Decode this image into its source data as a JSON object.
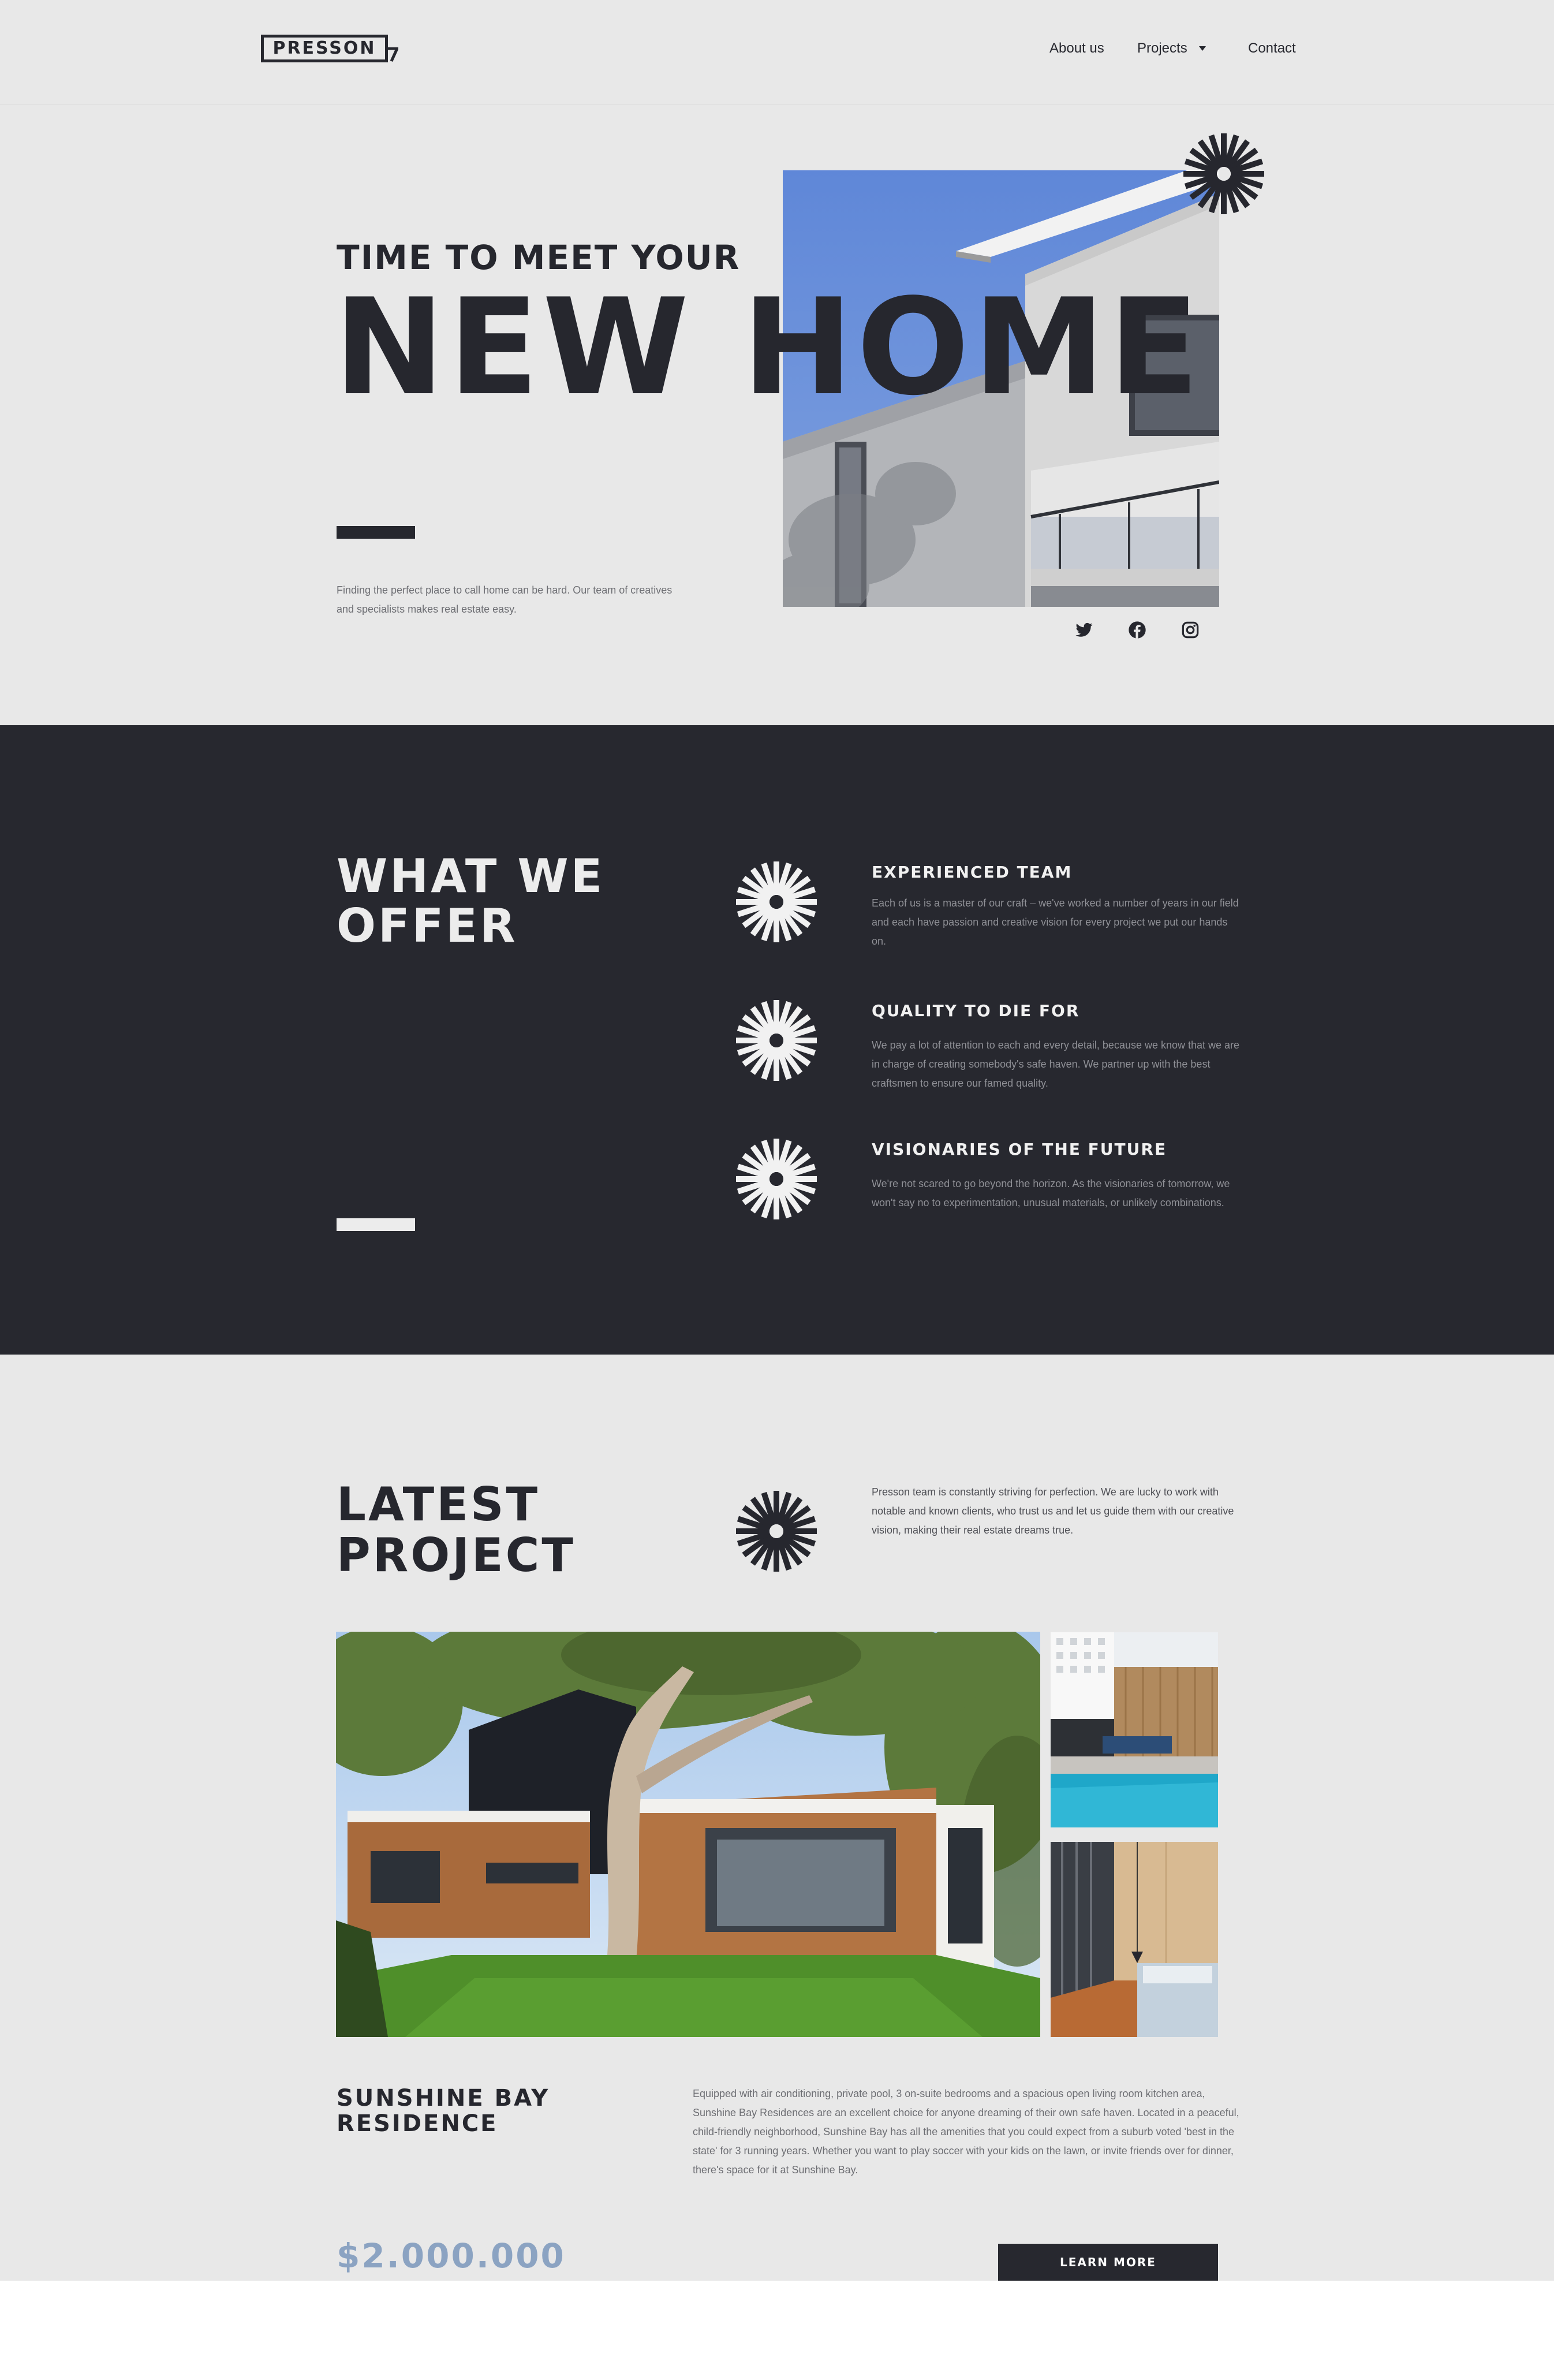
{
  "header": {
    "logo": "PRESSON",
    "nav": [
      {
        "label": "About us"
      },
      {
        "label": "Projects"
      },
      {
        "label": "Contact"
      }
    ]
  },
  "hero": {
    "kicker": "TIME TO MEET YOUR",
    "title": "NEW HOME",
    "description": "Finding the perfect place to call home can be hard. Our team of creatives and specialists makes real estate easy.",
    "social": [
      "twitter-icon",
      "facebook-icon",
      "instagram-icon"
    ]
  },
  "offer": {
    "title_line1": "WHAT WE",
    "title_line2": "OFFER",
    "features": [
      {
        "title": "EXPERIENCED TEAM",
        "text": "Each of us is a master of our craft – we've worked a number of years in our field and each have passion and creative vision for every project we put our hands on."
      },
      {
        "title": "QUALITY TO DIE FOR",
        "text": "We pay a lot of attention to each and every detail, because we know that we are in charge of creating somebody's safe haven. We partner up with the best craftsmen to ensure our famed quality."
      },
      {
        "title": "VISIONARIES OF THE FUTURE",
        "text": "We're not scared to go beyond the horizon. As the visionaries of tomorrow, we won't say no to experimentation, unusual materials, or unlikely combinations."
      }
    ]
  },
  "latest": {
    "title_line1": "LATEST",
    "title_line2": "PROJECT",
    "description": "Presson team is constantly striving for perfection. We are lucky to work with notable and known clients, who trust us and let us guide them with our creative vision, making their real estate dreams true.",
    "project_name": "SUNSHINE BAY RESIDENCE",
    "project_description": "Equipped with air conditioning, private pool, 3 on-suite bedrooms and a spacious open living room kitchen area, Sunshine Bay Residences are an excellent choice for anyone dreaming of their own safe haven. Located in a peaceful, child-friendly neighborhood, Sunshine Bay has all the amenities that you could expect from a suburb voted 'best in the state' for 3 running years. Whether you want to play soccer with your kids on the lawn, or invite friends over for dinner, there's space for it at Sunshine Bay.",
    "price": "$2.000.000",
    "cta": "LEARN MORE"
  },
  "colors": {
    "dark": "#27282f",
    "light": "#e8e8e8",
    "accent_price": "#8ba3c2"
  }
}
